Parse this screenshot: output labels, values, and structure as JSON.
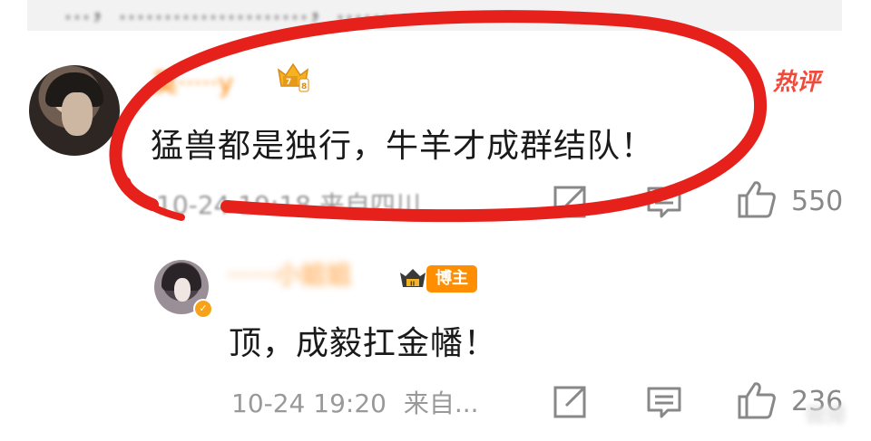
{
  "top_strip": {
    "text": "…，…………………，………"
  },
  "main_comment": {
    "username": "莫·····y",
    "text": "猛兽都是独行，牛羊才成群结队！",
    "meta": "10-24 19:18  来自四川",
    "hot_tag": "热评",
    "like_count": "550"
  },
  "reply_comment": {
    "username": "······小姐姐",
    "badge_label": "博主",
    "text": "顶，成毅扛金幡！",
    "time": "10-24 19:20",
    "source": "来自...",
    "like_count": "236"
  },
  "watermark": "微博",
  "colors": {
    "marker_red": "#e6211b",
    "username_orange": "#ff8200",
    "hot_red": "#f04a3a",
    "badge_orange": "#ff8f00",
    "meta_gray": "#999999"
  },
  "icons": {
    "share": "share-icon",
    "comment": "comment-icon",
    "like": "thumbs-up-icon"
  }
}
